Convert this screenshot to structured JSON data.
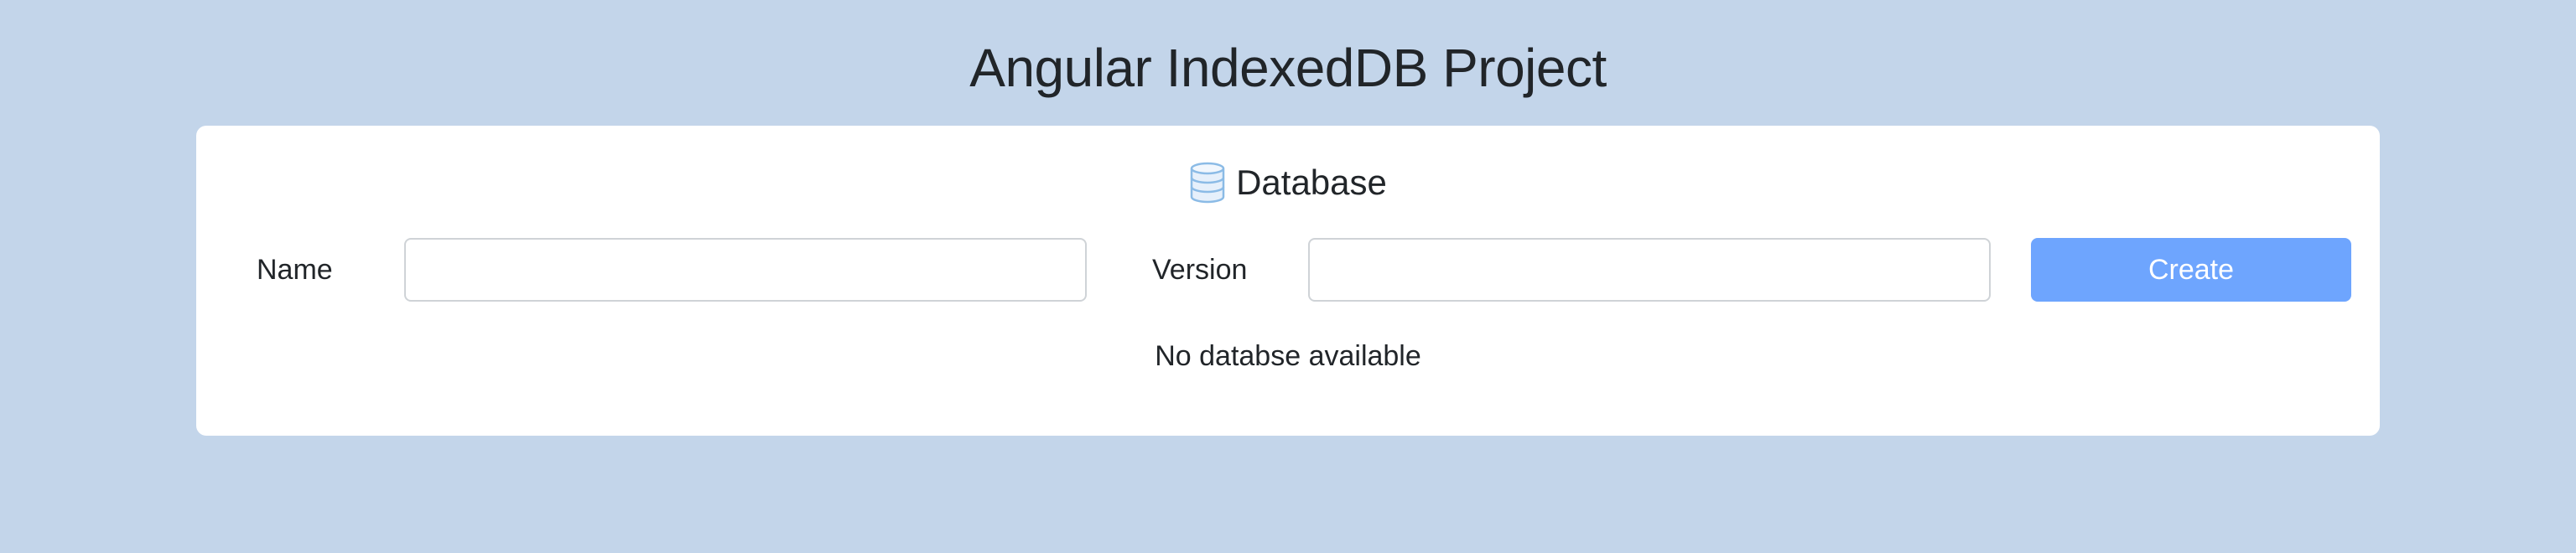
{
  "page": {
    "title": "Angular IndexedDB Project"
  },
  "database_card": {
    "heading": "Database",
    "heading_icon": "database-icon",
    "name_label": "Name",
    "name_value": "",
    "name_placeholder": "",
    "version_label": "Version",
    "version_value": "",
    "version_placeholder": "",
    "create_button_label": "Create",
    "empty_message": "No databse available"
  },
  "colors": {
    "background": "#c3d5ea",
    "card": "#ffffff",
    "button": "#6ea5fe",
    "icon": "#8bbbe6"
  }
}
